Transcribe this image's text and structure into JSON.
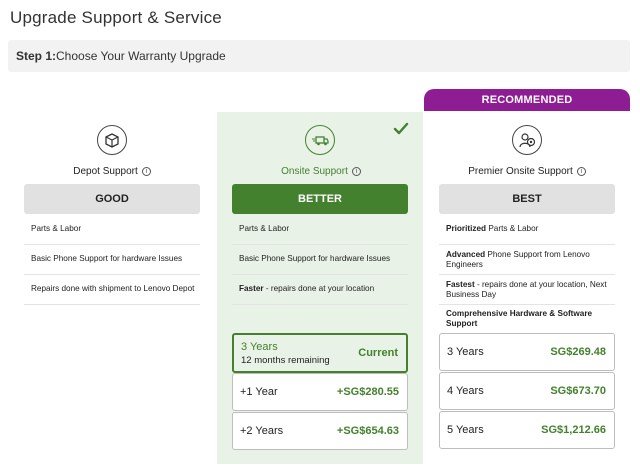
{
  "page": {
    "title": "Upgrade Support & Service",
    "step_label": "Step 1:",
    "step_text": "Choose Your Warranty Upgrade"
  },
  "tiers": [
    {
      "name": "Depot Support",
      "icon": "package-icon",
      "badge": "GOOD",
      "features": [
        {
          "bold": "",
          "text": "Parts & Labor"
        },
        {
          "bold": "",
          "text": "Basic Phone Support for hardware Issues"
        },
        {
          "bold": "",
          "text": "Repairs done with shipment to Lenovo Depot"
        }
      ]
    },
    {
      "name": "Onsite Support",
      "icon": "truck-icon",
      "badge": "BETTER",
      "selected": true,
      "features": [
        {
          "bold": "",
          "text": "Parts & Labor"
        },
        {
          "bold": "",
          "text": "Basic Phone Support for hardware Issues"
        },
        {
          "bold": "Faster",
          "text": " - repairs done at your location"
        }
      ],
      "options": [
        {
          "label": "3 Years",
          "sub": "12 months remaining",
          "price": "Current",
          "current": true
        },
        {
          "label": "+1 Year",
          "price": "+SG$280.55"
        },
        {
          "label": "+2 Years",
          "price": "+SG$654.63"
        }
      ]
    },
    {
      "name": "Premier Onsite Support",
      "icon": "support-agent-icon",
      "badge": "BEST",
      "ribbon": "RECOMMENDED",
      "features": [
        {
          "bold": "Prioritized",
          "text": " Parts & Labor"
        },
        {
          "bold": "Advanced",
          "text": " Phone Support from Lenovo Engineers"
        },
        {
          "bold": "Fastest",
          "text": " - repairs done at your location, Next Business Day"
        },
        {
          "bold": "Comprehensive Hardware & Software Support",
          "text": ""
        }
      ],
      "options": [
        {
          "label": "3 Years",
          "price": "SG$269.48"
        },
        {
          "label": "4 Years",
          "price": "SG$673.70"
        },
        {
          "label": "5 Years",
          "price": "SG$1,212.66"
        }
      ]
    }
  ],
  "colors": {
    "accent_green": "#43812e",
    "selected_bg": "#e9f2e6",
    "recommended_purple": "#8e1c93",
    "badge_gray": "#e1e1e1"
  },
  "info_glyph": "i"
}
